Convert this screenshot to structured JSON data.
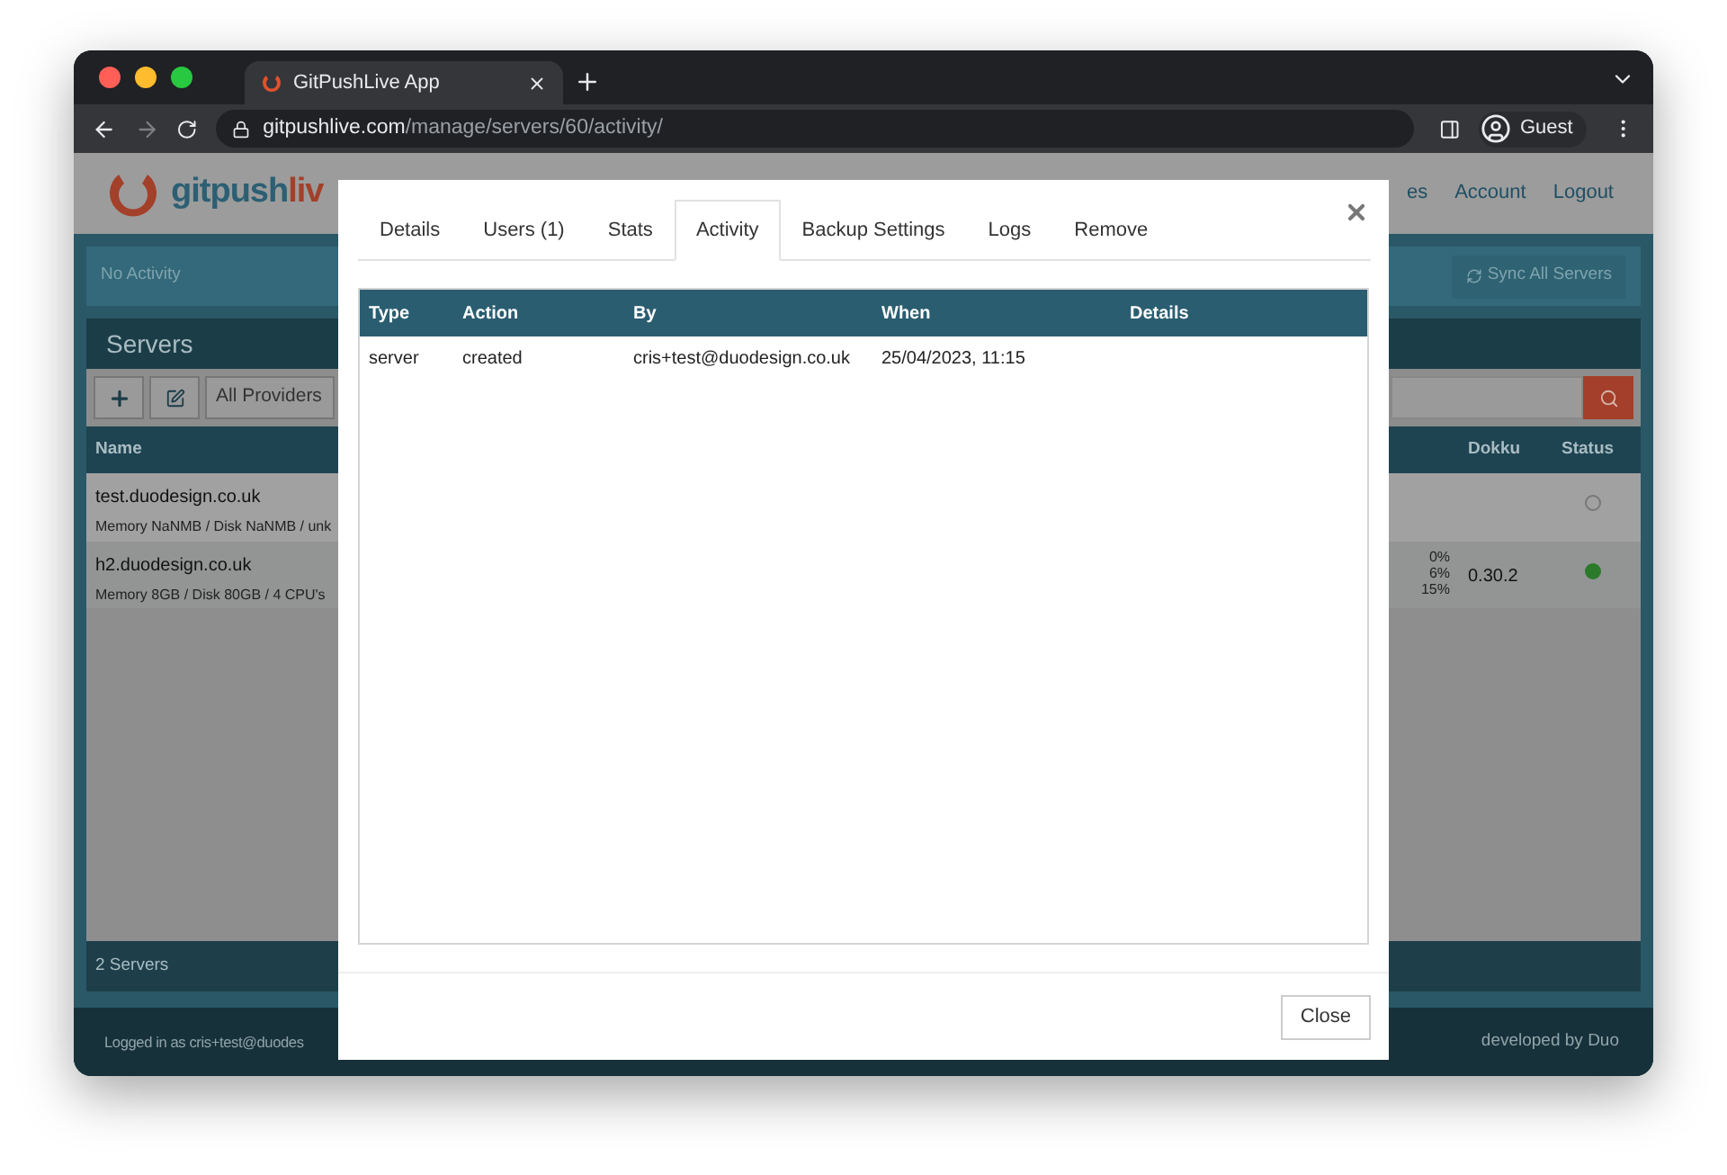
{
  "browser": {
    "tab_title": "GitPushLive App",
    "url_host": "gitpushlive.com",
    "url_path": "/manage/servers/60/activity/",
    "profile": "Guest"
  },
  "app": {
    "logo_first": "gitpush",
    "logo_second": "liv",
    "nav": [
      "es",
      "Account",
      "Logout"
    ]
  },
  "notice": {
    "text": "No Activity",
    "sync_button": "Sync All Servers"
  },
  "servers": {
    "title": "Servers",
    "provider_filter": "All Providers",
    "column_left": "Name",
    "columns_right": [
      "Dokku",
      "Status"
    ],
    "rows": [
      {
        "name": "test.duodesign.co.uk",
        "specs": "Memory NaNMB / Disk NaNMB / unk",
        "usage": [],
        "dokku": "",
        "online": false
      },
      {
        "name": "h2.duodesign.co.uk",
        "specs": "Memory 8GB / Disk 80GB / 4 CPU's",
        "usage": [
          "0%",
          "6%",
          "15%"
        ],
        "dokku": "0.30.2",
        "online": true
      }
    ],
    "count": "2 Servers"
  },
  "footer": {
    "logged_in": "Logged in as cris+test@duodes",
    "credit": "developed by Duo"
  },
  "modal": {
    "tabs": [
      {
        "label": "Details",
        "selected": false
      },
      {
        "label": "Users (1)",
        "selected": false
      },
      {
        "label": "Stats",
        "selected": false
      },
      {
        "label": "Activity",
        "selected": true
      },
      {
        "label": "Backup Settings",
        "selected": false
      },
      {
        "label": "Logs",
        "selected": false
      },
      {
        "label": "Remove",
        "selected": false
      }
    ],
    "columns": [
      "Type",
      "Action",
      "By",
      "When",
      "Details"
    ],
    "rows": [
      [
        "server",
        "created",
        "cris+test@duodesign.co.uk",
        "25/04/2023, 11:15",
        ""
      ]
    ],
    "close_button": "Close"
  }
}
